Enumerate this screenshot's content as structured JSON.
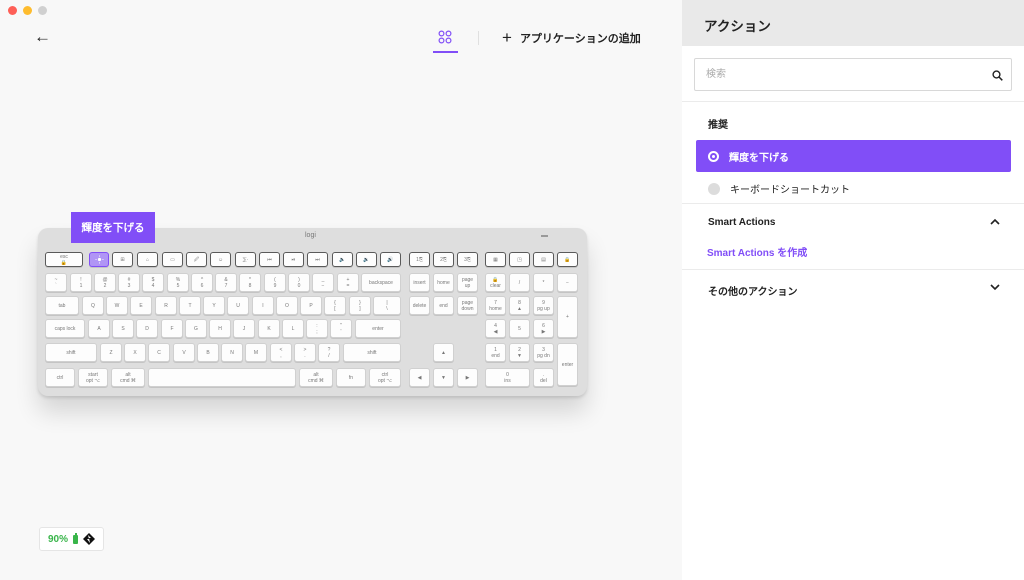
{
  "window": {
    "controls": {
      "close_color": "#fe5f57",
      "minimize_color": "#febc2e",
      "zoom_color": "#d0d0d0"
    }
  },
  "toolbar": {
    "back_icon": "←",
    "apps_icon": "grid-icon",
    "add_app_plus": "+",
    "add_app_label": "アプリケーションの追加"
  },
  "tooltip": {
    "label": "輝度を下げる"
  },
  "keyboard": {
    "logo": "logi",
    "keys": {
      "esc": "esc\n🔒",
      "f3": "⊞",
      "f4": "⌂",
      "f5": "▭",
      "f6": "🖉",
      "f7": "☺",
      "f8": "⅀·",
      "f9": "⏮",
      "f10": "⏯",
      "f11": "⏭",
      "f12": "🔈",
      "f13": "🔉",
      "f14": "🔊",
      "b1": "1⎘",
      "b2": "2⎘",
      "b3": "3⎘",
      "calc": "▦",
      "scr": "◳",
      "menu": "▤",
      "lock": "🔒",
      "tilde": "~\n`",
      "n1": "!\n1",
      "n2": "@\n2",
      "n3": "#\n3",
      "n4": "$\n4",
      "n5": "%\n5",
      "n6": "^\n6",
      "n7": "&\n7",
      "n8": "*\n8",
      "n9": "(\n9",
      "n0": ")\n0",
      "minus": "_\n−",
      "plus": "+\n=",
      "backspace": "backspace",
      "insert": "insert",
      "home": "home",
      "pgup": "page\nup",
      "clear": "🔒\nclear",
      "np_slash": "/",
      "np_star": "*",
      "np_minus": "−",
      "tab": "tab",
      "q": "Q",
      "w": "W",
      "e": "E",
      "r": "R",
      "t": "T",
      "y": "Y",
      "u": "U",
      "i": "I",
      "o": "O",
      "p": "P",
      "lbrace": "{\n[",
      "rbrace": "}\n]",
      "bslash": "|\n\\",
      "delete": "delete",
      "end": "end",
      "pgdn": "page\ndown",
      "np7": "7\nhome",
      "np8": "8\n▲",
      "np9": "9\npg up",
      "np_plus": "+",
      "caps": "caps lock",
      "a": "A",
      "s": "S",
      "d": "D",
      "f": "F",
      "g": "G",
      "h": "H",
      "j": "J",
      "k": "K",
      "l": "L",
      "semi": ":\n;",
      "quote": "\"\n'",
      "enter": "enter",
      "np4": "4\n◀",
      "np5": "5",
      "np6": "6\n▶",
      "shift_l": "shift",
      "z": "Z",
      "x": "X",
      "c": "C",
      "v": "V",
      "b": "B",
      "n": "N",
      "m": "M",
      "comma": "<\n,",
      "period": ">\n.",
      "slash": "?\n/",
      "shift_r": "shift",
      "up": "▲",
      "np1": "1\nend",
      "np2": "2\n▼",
      "np3": "3\npg dn",
      "np_enter": "enter",
      "ctrl": "ctrl",
      "start": "start\nopt ⌥",
      "alt": "alt\ncmd ⌘",
      "space": "",
      "altgr": "alt\ncmd ⌘",
      "fnkey": "fn",
      "ctx": "ctrl\nopt ⌥",
      "left": "◀",
      "down": "▼",
      "right": "▶",
      "np0": "0\nins",
      "np_dot": ".\ndel"
    }
  },
  "battery": {
    "percent": "90%"
  },
  "panel": {
    "title": "アクション",
    "search_placeholder": "検索",
    "recommended_label": "推奨",
    "options": [
      {
        "label": "輝度を下げる",
        "selected": true
      },
      {
        "label": "キーボードショートカット",
        "selected": false
      }
    ],
    "smart_actions": {
      "label": "Smart Actions",
      "chevron": "⌃",
      "create_link": "Smart Actions を作成"
    },
    "other_actions": {
      "label": "その他のアクション",
      "chevron": "⌄"
    }
  },
  "colors": {
    "accent": "#814ef7",
    "battery_green": "#39b54a"
  }
}
